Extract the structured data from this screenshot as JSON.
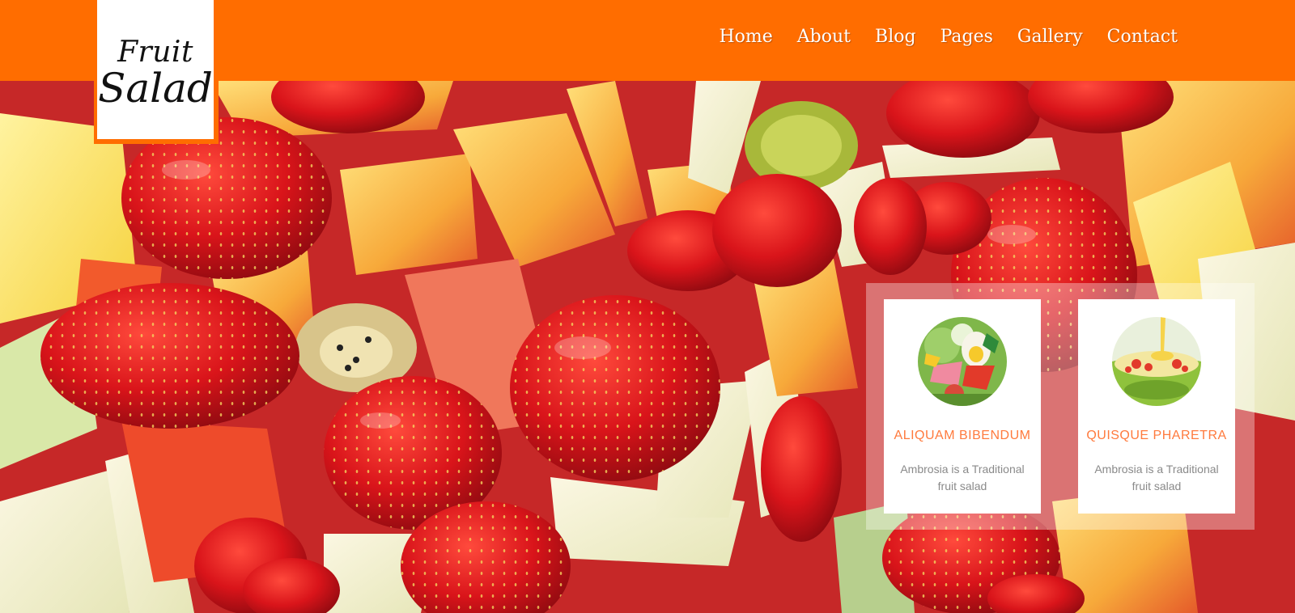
{
  "brand": {
    "line1": "Fruit",
    "line2": "Salad"
  },
  "nav": [
    {
      "label": "Home"
    },
    {
      "label": "About"
    },
    {
      "label": "Blog"
    },
    {
      "label": "Pages"
    },
    {
      "label": "Gallery"
    },
    {
      "label": "Contact"
    }
  ],
  "hero": {
    "image": "fruit-salad-photo"
  },
  "features": [
    {
      "title": "ALIQUAM BIBENDUM",
      "text": "Ambrosia is a Traditional fruit salad",
      "image": "vegetable-salad-thumbnail"
    },
    {
      "title": "QUISQUE PHARETRA",
      "text": "Ambrosia is a Traditional fruit salad",
      "image": "fruit-bowl-thumbnail"
    }
  ],
  "colors": {
    "accent": "#ff6d00",
    "card_title": "#ff7a3d",
    "card_text": "#8a8a8a"
  }
}
